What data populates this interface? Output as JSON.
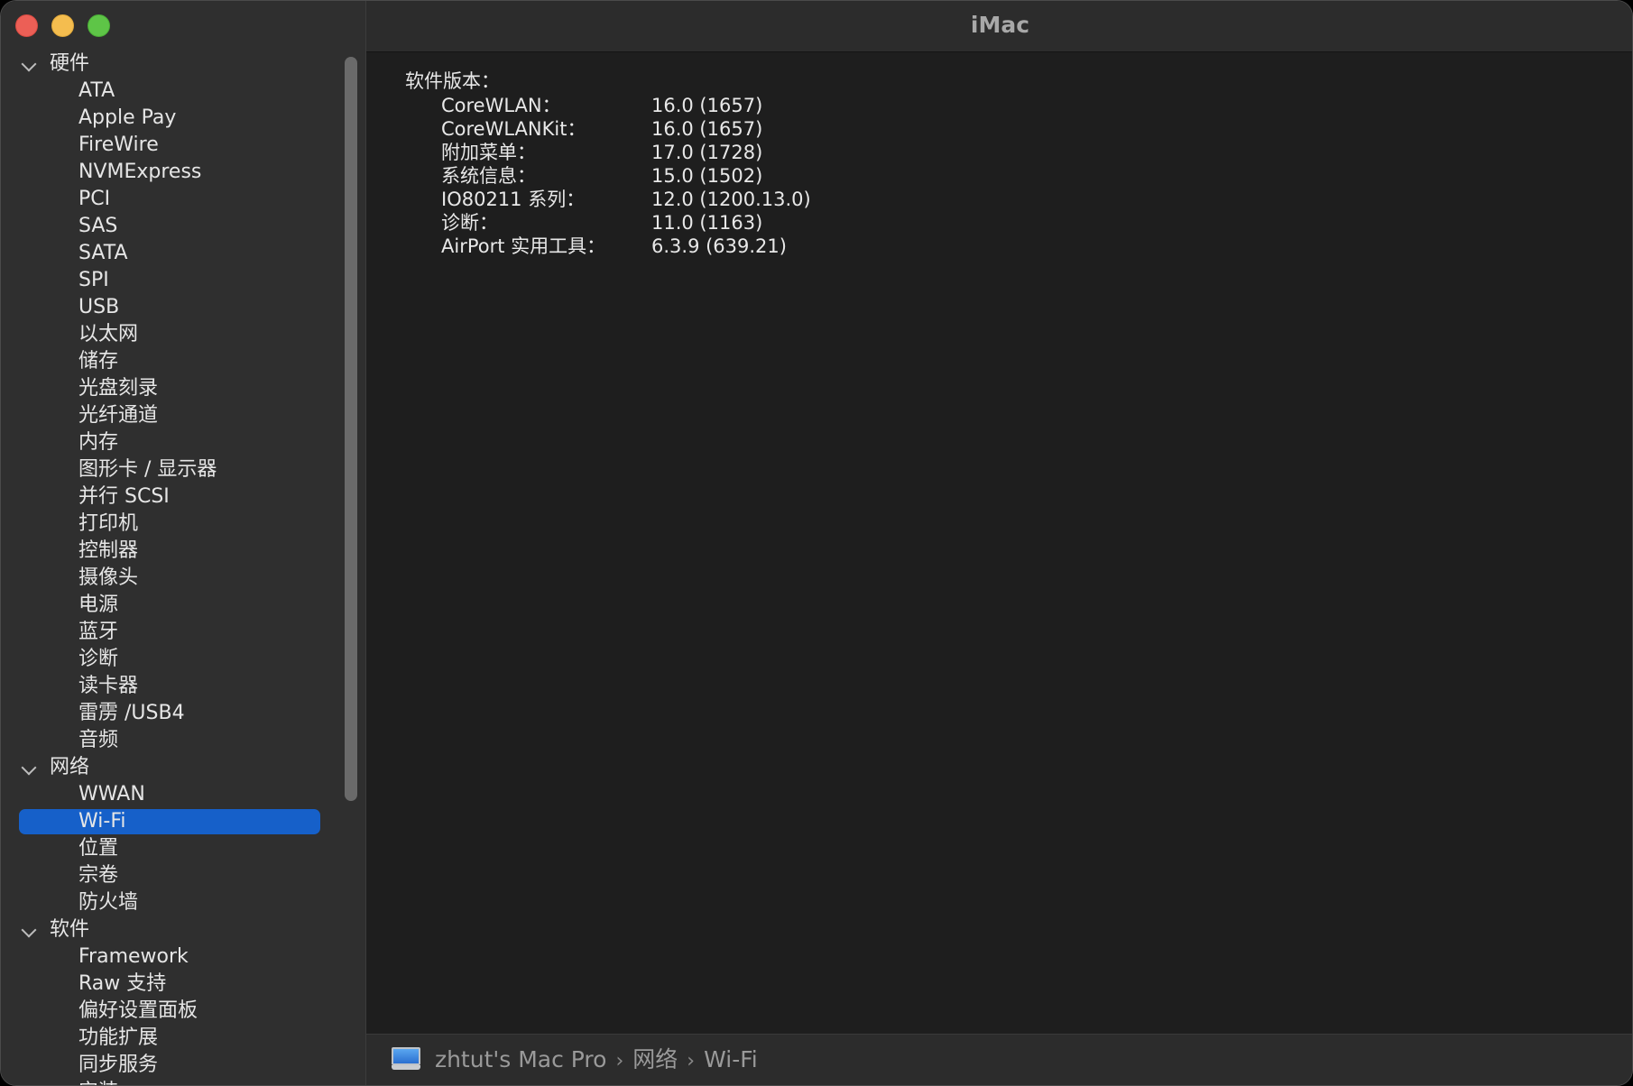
{
  "window": {
    "title": "iMac"
  },
  "sidebar": {
    "groups": [
      {
        "label": "硬件",
        "items": [
          "ATA",
          "Apple Pay",
          "FireWire",
          "NVMExpress",
          "PCI",
          "SAS",
          "SATA",
          "SPI",
          "USB",
          "以太网",
          "储存",
          "光盘刻录",
          "光纤通道",
          "内存",
          "图形卡 / 显示器",
          "并行 SCSI",
          "打印机",
          "控制器",
          "摄像头",
          "电源",
          "蓝牙",
          "诊断",
          "读卡器",
          "雷雳 /USB4",
          "音频"
        ]
      },
      {
        "label": "网络",
        "items": [
          "WWAN",
          "Wi-Fi",
          "位置",
          "宗卷",
          "防火墙"
        ]
      },
      {
        "label": "软件",
        "items": [
          "Framework",
          "Raw 支持",
          "偏好设置面板",
          "功能扩展",
          "同步服务",
          "安装"
        ]
      }
    ],
    "selected_item": "Wi-Fi"
  },
  "content": {
    "section_title": "软件版本：",
    "rows": [
      {
        "key": "CoreWLAN：",
        "value": "16.0 (1657)"
      },
      {
        "key": "CoreWLANKit：",
        "value": "16.0 (1657)"
      },
      {
        "key": "附加菜单：",
        "value": "17.0 (1728)"
      },
      {
        "key": "系统信息：",
        "value": "15.0 (1502)"
      },
      {
        "key": "IO80211 系列：",
        "value": "12.0 (1200.13.0)"
      },
      {
        "key": "诊断：",
        "value": "11.0 (1163)"
      },
      {
        "key": "AirPort 实用工具：",
        "value": "6.3.9 (639.21)"
      }
    ]
  },
  "pathbar": {
    "icon": "computer-icon",
    "segments": [
      "zhtut's Mac Pro",
      "网络",
      "Wi-Fi"
    ],
    "separator": "›"
  }
}
